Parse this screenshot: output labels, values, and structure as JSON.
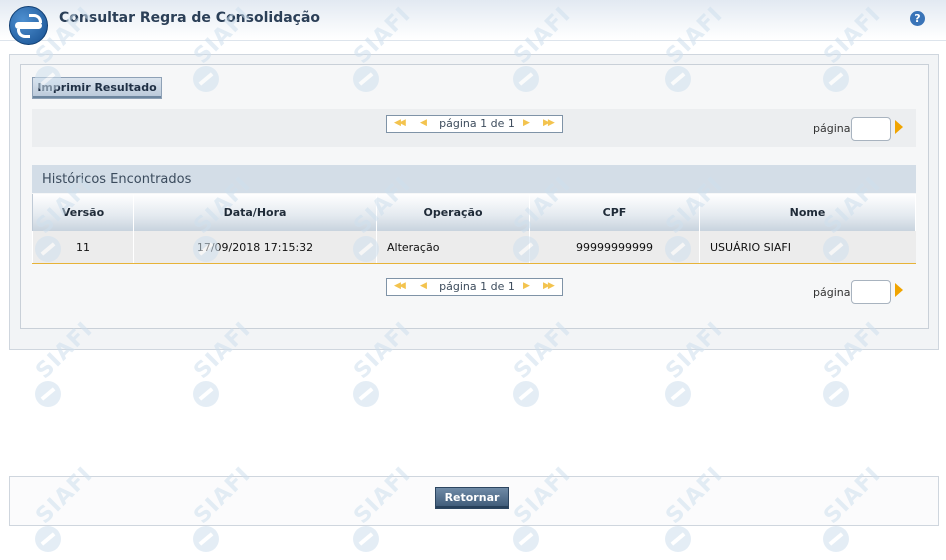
{
  "header": {
    "title": "Consultar Regra de Consolidação",
    "help_icon": "?"
  },
  "watermark": {
    "text": "SIAFI"
  },
  "toolbar": {
    "print_label": "Imprimir Resultado"
  },
  "pagination": {
    "label": "página 1 de 1",
    "goto_label": "página",
    "goto_value": ""
  },
  "results": {
    "title": "Históricos Encontrados",
    "columns": [
      "Versão",
      "Data/Hora",
      "Operação",
      "CPF",
      "Nome"
    ],
    "rows": [
      [
        "11",
        "17/09/2018 17:15:32",
        "Alteração",
        "99999999999",
        "USUÁRIO SIAFI"
      ]
    ]
  },
  "footer": {
    "return_label": "Retornar"
  },
  "colors": {
    "title_text": "#2b3f57",
    "row_border": "#e7b338",
    "pager_arrows": "#f3c34e",
    "goto_arrow": "#f0a400",
    "primary_button": "#3c5876"
  }
}
